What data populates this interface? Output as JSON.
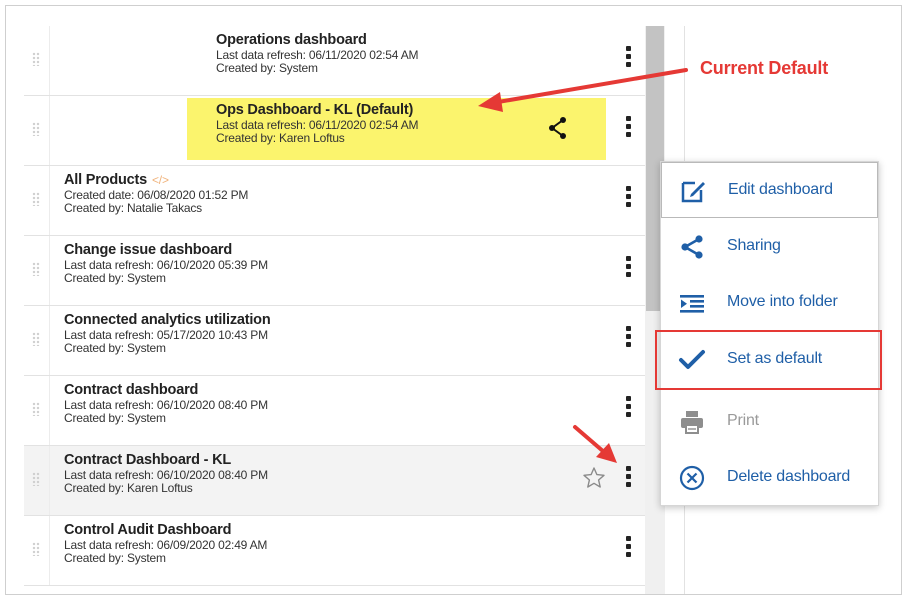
{
  "callout": {
    "text": "Current Default"
  },
  "rows": [
    {
      "title": "Operations dashboard",
      "line1": "Last data refresh: 06/11/2020 02:54 AM",
      "line2": "Created by: System"
    },
    {
      "title": "Ops Dashboard - KL (Default)",
      "line1": "Last data refresh: 06/11/2020 02:54 AM",
      "line2": "Created by: Karen Loftus"
    },
    {
      "title": "All Products",
      "line1": "Created date: 06/08/2020 01:52 PM",
      "line2": "Created by: Natalie Takacs",
      "badge_icon": "code-icon"
    },
    {
      "title": "Change issue dashboard",
      "line1": "Last data refresh: 06/10/2020 05:39 PM",
      "line2": "Created by: System"
    },
    {
      "title": "Connected analytics utilization",
      "line1": "Last data refresh: 05/17/2020 10:43 PM",
      "line2": "Created by: System"
    },
    {
      "title": "Contract dashboard",
      "line1": "Last data refresh: 06/10/2020 08:40 PM",
      "line2": "Created by: System"
    },
    {
      "title": "Contract Dashboard - KL",
      "line1": "Last data refresh: 06/10/2020 08:40 PM",
      "line2": "Created by: Karen Loftus"
    },
    {
      "title": "Control Audit Dashboard",
      "line1": "Last data refresh: 06/09/2020 02:49 AM",
      "line2": "Created by: System"
    }
  ],
  "menu": {
    "items": [
      {
        "label": "Edit dashboard",
        "icon": "edit-icon"
      },
      {
        "label": "Sharing",
        "icon": "share-icon"
      },
      {
        "label": "Move into folder",
        "icon": "move-folder-icon"
      },
      {
        "label": "Set as default",
        "icon": "checkmark-icon"
      },
      {
        "label": "Print",
        "icon": "print-icon",
        "disabled": true
      },
      {
        "label": "Delete dashboard",
        "icon": "delete-icon"
      }
    ]
  },
  "colors": {
    "accent": "#1f5fa7",
    "highlight": "#fbf46d",
    "annotation": "#e53935"
  }
}
